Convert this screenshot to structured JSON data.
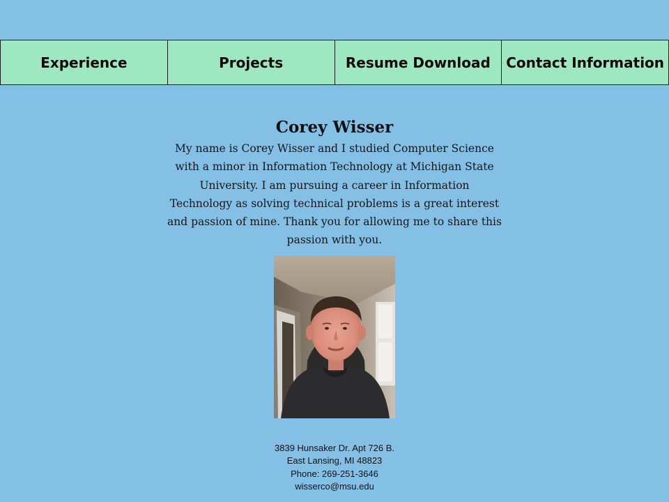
{
  "nav": {
    "items": [
      {
        "label": "Experience"
      },
      {
        "label": "Projects"
      },
      {
        "label": "Resume Download"
      },
      {
        "label": "Contact Information"
      }
    ]
  },
  "profile": {
    "name": "Corey Wisser",
    "bio": "My name is Corey Wisser and I studied Computer Science with a minor in Information Technology at Michigan State University. I am pursuing a career in Information Technology as solving technical problems is a great interest and passion of mine. Thank you for allowing me to share this passion with you."
  },
  "contact": {
    "address_line1": "3839 Hunsaker Dr. Apt 726 B.",
    "address_line2": "East Lansing, MI 48823",
    "phone": "Phone: 269-251-3646",
    "email": "wisserco@msu.edu"
  },
  "colors": {
    "page_background": "#84bfe6",
    "nav_background": "#9ee8c1",
    "nav_border": "#1b1b1b"
  }
}
